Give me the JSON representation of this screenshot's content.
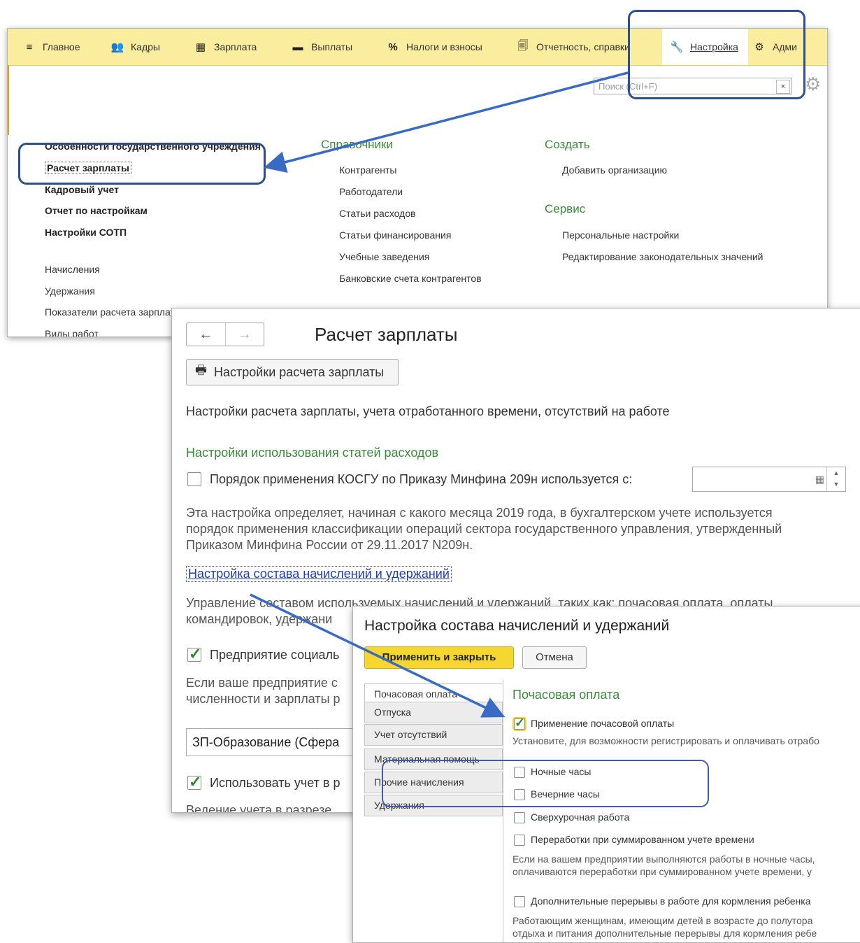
{
  "menu": {
    "items": [
      {
        "label": "Главное",
        "icon": "menu-icon"
      },
      {
        "label": "Кадры",
        "icon": "people-icon"
      },
      {
        "label": "Зарплата",
        "icon": "calculator-icon"
      },
      {
        "label": "Выплаты",
        "icon": "wallet-icon"
      },
      {
        "label": "Налоги и взносы",
        "icon": "percent-icon"
      },
      {
        "label": "Отчетность, справки",
        "icon": "document-icon"
      },
      {
        "label": "Настройка",
        "icon": "wrench-icon"
      },
      {
        "label": "Адми",
        "icon": "gear-icon"
      }
    ],
    "search_placeholder": "Поиск (Ctrl+F)",
    "search_clear": "×",
    "left_column": {
      "bold_items": [
        "Особенности государственного учреждения",
        "Расчет зарплаты",
        "Кадровый учет",
        "Отчет по настройкам",
        "Настройки СОТП"
      ],
      "items": [
        "Начисления",
        "Удержания",
        "Показатели расчета зарплаты",
        "Виды работ"
      ]
    },
    "directories": {
      "heading": "Справочники",
      "items": [
        "Контрагенты",
        "Работодатели",
        "Статьи расходов",
        "Статьи финансирования",
        "Учебные заведения",
        "Банковские счета контрагентов"
      ]
    },
    "create": {
      "heading": "Создать",
      "items": [
        "Добавить организацию"
      ]
    },
    "service": {
      "heading": "Сервис",
      "items": [
        "Персональные настройки",
        "Редактирование законодательных значений"
      ]
    }
  },
  "payroll": {
    "nav_back": "←",
    "nav_forward": "→",
    "title": "Расчет зарплаты",
    "print_button": "Настройки расчета зарплаты",
    "description": "Настройки расчета зарплаты, учета отработанного времени, отсутствий на работе",
    "expenses_heading": "Настройки использования статей расходов",
    "kosgu_label": "Порядок применения КОСГУ по Приказу Минфина 209н используется с:",
    "kosgu_hint_1": "Эта настройка определяет, начиная с какого месяца 2019 года, в бухгалтерском учете используется",
    "kosgu_hint_2": "порядок применения классификации операций сектора государственного управления, утвержденный",
    "kosgu_hint_3": "Приказом Минфина России от 29.11.2017 N209н.",
    "composition_link": "Настройка состава начислений и удержаний",
    "composition_hint_1": "Управление составом используемых начислений и удержаний, таких как: почасовая оплата, оплаты",
    "composition_hint_2": "командировок, удержани",
    "social_label": "Предприятие социаль",
    "social_hint_1": "Если ваше предприятие с",
    "social_hint_2": "численности и зарплаты р",
    "select_value": "ЗП-Образование (Сфера",
    "use_accounting_label": "Использовать учет в р",
    "accounting_hint": "Ведение учета в разрезе"
  },
  "composition": {
    "title": "Настройка состава начислений и удержаний",
    "apply_button": "Применить и закрыть",
    "cancel_button": "Отмена",
    "tabs": [
      "Почасовая оплата",
      "Отпуска",
      "Учет отсутствий",
      "Материальная помощь",
      "Прочие начисления",
      "Удержания"
    ],
    "section_heading": "Почасовая оплата",
    "hourly_label": "Применение почасовой оплаты",
    "hourly_hint": "Установите, для возможности регистрировать и оплачивать отрабо",
    "night_label": "Ночные часы",
    "evening_label": "Вечерние часы",
    "overtime_label": "Сверхурочная работа",
    "summary_label": "Переработки при суммированном учете времени",
    "work_hint_1": "Если на вашем предприятии выполняются работы в ночные часы,",
    "work_hint_2": "оплачиваются переработки при суммированном учете времени, у",
    "breaks_label": "Дополнительные перерывы в работе для кормления ребенка",
    "breaks_hint_1": "Работающим женщинам, имеющим детей в возрасте до полутора",
    "breaks_hint_2": "отдыха и питания дополнительные перерывы для кормления ребе"
  },
  "colors": {
    "menu_bar": "#fbed9e",
    "accent_green": "#3b8a3b",
    "link_blue": "#1f3fa8",
    "annotation_blue": "#2d4f8e",
    "apply_yellow": "#f5d730"
  }
}
